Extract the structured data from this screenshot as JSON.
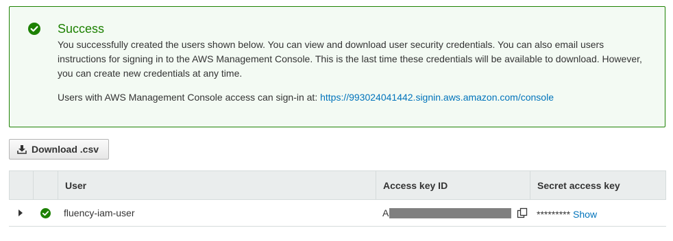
{
  "alert": {
    "title": "Success",
    "body": "You successfully created the users shown below. You can view and download user security credentials. You can also email users instructions for signing in to the AWS Management Console. This is the last time these credentials will be available to download. However, you can create new credentials at any time.",
    "signin_prefix": "Users with AWS Management Console access can sign-in at: ",
    "signin_url": "https://993024041442.signin.aws.amazon.com/console",
    "status_color": "#1d8102"
  },
  "toolbar": {
    "download_label": "Download .csv"
  },
  "table": {
    "columns": [
      "User",
      "Access key ID",
      "Secret access key"
    ],
    "rows": [
      {
        "user": "fluency-iam-user",
        "access_key_prefix": "A",
        "secret_masked": "*********",
        "show_label": "Show"
      }
    ]
  },
  "icons": {
    "alert": "check-circle-icon",
    "download": "download-icon",
    "expand": "caret-right-icon",
    "row_status": "check-circle-icon",
    "copy": "copy-icon"
  },
  "colors": {
    "link": "#0073bb",
    "success": "#1d8102",
    "header_bg": "#eaeded"
  }
}
